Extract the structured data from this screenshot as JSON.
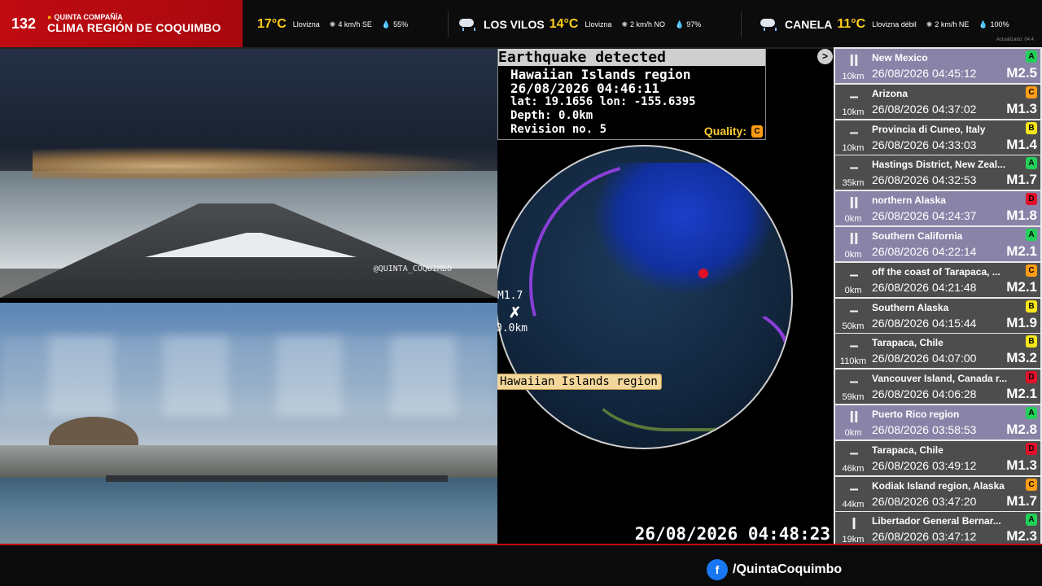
{
  "brand": {
    "number": "132",
    "subtitle": "QUINTA COMPAÑÍA",
    "title": "CLIMA REGIÓN DE COQUIMBO"
  },
  "weather": [
    {
      "city": "",
      "temp": "17°C",
      "condition": "Llovizna",
      "wind": "4 km/h SE",
      "humidity": "55%"
    },
    {
      "city": "LOS VILOS",
      "temp": "14°C",
      "condition": "Llovizna",
      "wind": "2 km/h NO",
      "humidity": "97%"
    },
    {
      "city": "CANELA",
      "temp": "11°C",
      "condition": "Llovizna débil",
      "wind": "2 km/h NE",
      "humidity": "100%"
    }
  ],
  "weather_updated": "Actualizado: 04:4",
  "cameras": {
    "cam1_credit": "@QUINTA_COQUIMBO"
  },
  "alert": {
    "title": "Earthquake detected",
    "region": "Hawaiian Islands region",
    "datetime": "26/08/2026 04:46:11",
    "coords": "lat: 19.1656 lon: -155.6395",
    "depth": "Depth: 0.0km",
    "revision": "Revision no. 5",
    "quality_label": "Quality:",
    "quality": "C"
  },
  "map": {
    "marker_mag": "M1.7",
    "marker_depth": "0.0km",
    "region_tag": "Hawaiian Islands region",
    "next_button": ">",
    "clock": "26/08/2026 04:48:23"
  },
  "quakes": [
    {
      "place": "New Mexico",
      "time": "26/08/2026 04:45:12",
      "mag": "M2.5",
      "depth": "10km",
      "quality": "A",
      "mark": "II",
      "highlight": true
    },
    {
      "place": "Arizona",
      "time": "26/08/2026 04:37:02",
      "mag": "M1.3",
      "depth": "10km",
      "quality": "C",
      "mark": "–",
      "highlight": false
    },
    {
      "place": "Provincia di Cuneo, Italy",
      "time": "26/08/2026 04:33:03",
      "mag": "M1.4",
      "depth": "10km",
      "quality": "B",
      "mark": "–",
      "highlight": false
    },
    {
      "place": "Hastings District, New Zeal...",
      "time": "26/08/2026 04:32:53",
      "mag": "M1.7",
      "depth": "35km",
      "quality": "A",
      "mark": "–",
      "highlight": false
    },
    {
      "place": "northern Alaska",
      "time": "26/08/2026 04:24:37",
      "mag": "M1.8",
      "depth": "0km",
      "quality": "D",
      "mark": "II",
      "highlight": true
    },
    {
      "place": "Southern California",
      "time": "26/08/2026 04:22:14",
      "mag": "M2.1",
      "depth": "0km",
      "quality": "A",
      "mark": "II",
      "highlight": true
    },
    {
      "place": "off the coast of Tarapaca, ...",
      "time": "26/08/2026 04:21:48",
      "mag": "M2.1",
      "depth": "0km",
      "quality": "C",
      "mark": "–",
      "highlight": false
    },
    {
      "place": "Southern Alaska",
      "time": "26/08/2026 04:15:44",
      "mag": "M1.9",
      "depth": "50km",
      "quality": "B",
      "mark": "–",
      "highlight": false
    },
    {
      "place": "Tarapaca, Chile",
      "time": "26/08/2026 04:07:00",
      "mag": "M3.2",
      "depth": "110km",
      "quality": "B",
      "mark": "–",
      "highlight": false
    },
    {
      "place": "Vancouver Island, Canada r...",
      "time": "26/08/2026 04:06:28",
      "mag": "M2.1",
      "depth": "59km",
      "quality": "D",
      "mark": "–",
      "highlight": false
    },
    {
      "place": "Puerto Rico region",
      "time": "26/08/2026 03:58:53",
      "mag": "M2.8",
      "depth": "0km",
      "quality": "A",
      "mark": "II",
      "highlight": true
    },
    {
      "place": "Tarapaca, Chile",
      "time": "26/08/2026 03:49:12",
      "mag": "M1.3",
      "depth": "46km",
      "quality": "D",
      "mark": "–",
      "highlight": false
    },
    {
      "place": "Kodiak Island region, Alaska",
      "time": "26/08/2026 03:47:20",
      "mag": "M1.7",
      "depth": "44km",
      "quality": "C",
      "mark": "–",
      "highlight": false
    },
    {
      "place": "Libertador General Bernar...",
      "time": "26/08/2026 03:47:12",
      "mag": "M2.3",
      "depth": "19km",
      "quality": "A",
      "mark": "I",
      "highlight": false
    }
  ],
  "footer": {
    "facebook_icon": "f",
    "handle": "/QuintaCoquimbo"
  },
  "colors": {
    "brand_red": "#c00b12",
    "temp_yellow": "#ffcf1a",
    "row_dark": "#4d4d4d",
    "row_highlight": "#8a83a8"
  }
}
